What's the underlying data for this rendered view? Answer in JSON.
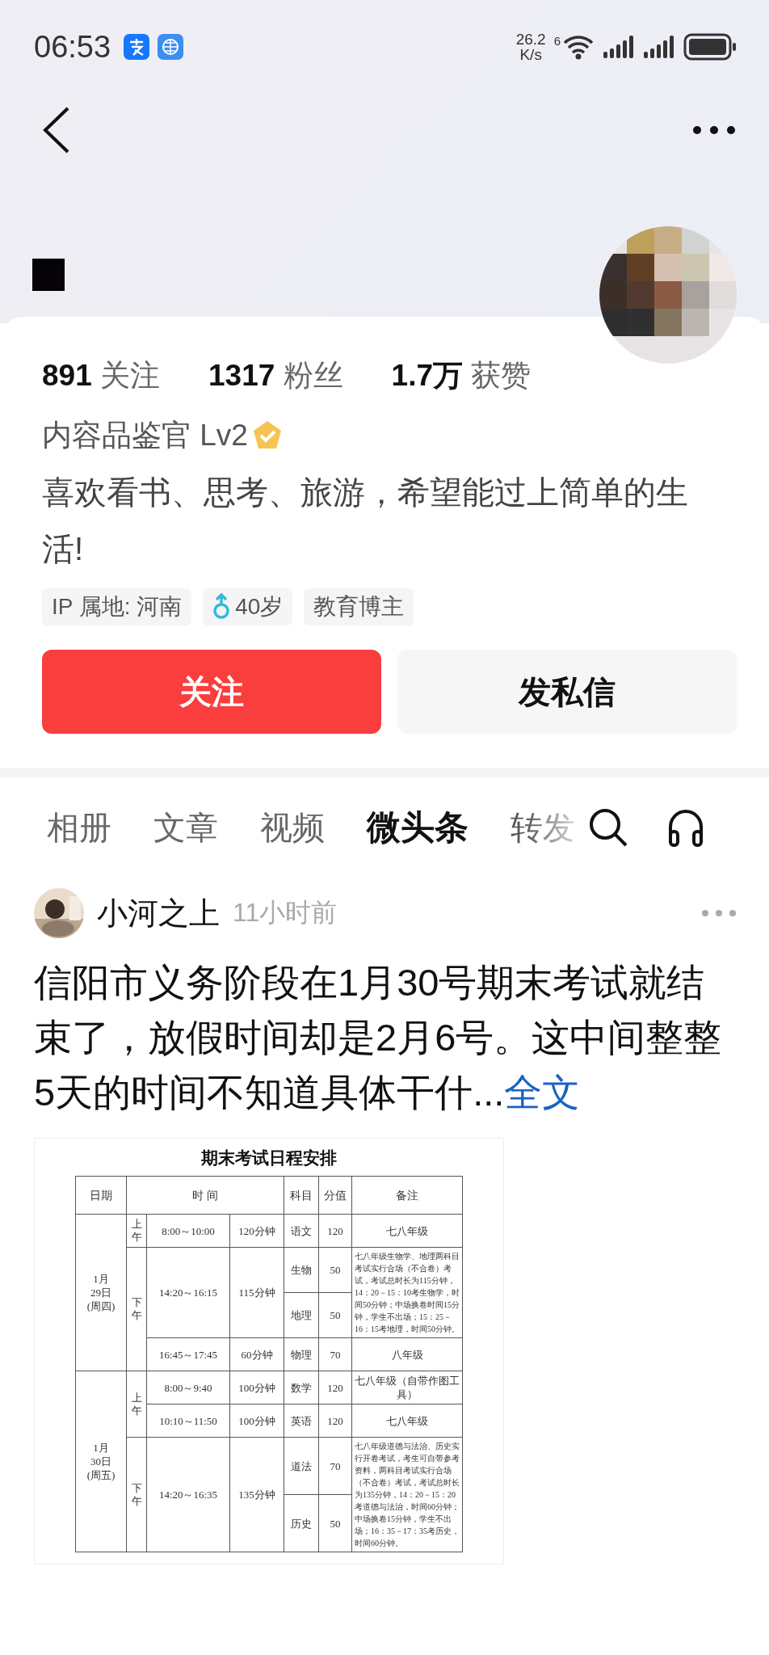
{
  "status_bar": {
    "time": "06:53",
    "speed_value": "26.2",
    "speed_unit": "K/s",
    "wifi_badge": "6"
  },
  "profile": {
    "stats": [
      "**891** 关注",
      "**1317** 粉丝",
      "**1.7万** 获赞"
    ],
    "title": "内容品鉴官 Lv2",
    "verified": true,
    "bio": "喜欢看书、思考、旅游，希望能过上简单的生活!",
    "tags": [
      {
        "kind": "text",
        "label": "IP 属地: 河南"
      },
      {
        "kind": "gender",
        "label": "40岁"
      },
      {
        "kind": "text",
        "label": "教育博主"
      }
    ],
    "buttons": [
      {
        "kind": "primary",
        "label": "关注"
      },
      {
        "kind": "secondary",
        "label": "发私信"
      }
    ]
  },
  "tabs": [
    {
      "label": "相册",
      "selected": false,
      "faded": false
    },
    {
      "label": "文章",
      "selected": false,
      "faded": false
    },
    {
      "label": "视频",
      "selected": false,
      "faded": false
    },
    {
      "label": "微头条",
      "selected": true,
      "faded": false
    },
    {
      "label": "转发",
      "selected": false,
      "faded": true
    }
  ],
  "post": {
    "author": "小河之上",
    "time": "11小时前",
    "text": "信阳市义务阶段在1月30号期末考试就结束了，放假时间却是2月6号。这中间整整5天的时间不知道具体干什...",
    "more_link": "全文",
    "document": {
      "title": "期末考试日程安排",
      "columns": [
        "日期",
        "时 间",
        "科目",
        "分值",
        "备注"
      ],
      "days": [
        {
          "date_lines": [
            "1月",
            "29日",
            "(周四)"
          ],
          "sessions": [
            {
              "half": "上午",
              "slots": [
                {
                  "time": "8:00～10:00",
                  "duration": "120分钟",
                  "subjects": [
                    {
                      "subject": "语文",
                      "score": "120"
                    }
                  ],
                  "note": "七八年级"
                }
              ]
            },
            {
              "half": "下午",
              "slots": [
                {
                  "time": "14:20～16:15",
                  "duration": "115分钟",
                  "subjects": [
                    {
                      "subject": "生物",
                      "score": "50"
                    },
                    {
                      "subject": "地理",
                      "score": "50"
                    }
                  ],
                  "note": "七八年级生物学、地理两科目考试实行合场（不合卷）考试，考试总时长为115分钟，14：20－15：10考生物学，时间50分钟；中场换卷时间15分钟，学生不出场；15：25－16：15考地理，时间50分钟。"
                },
                {
                  "time": "16:45～17:45",
                  "duration": "60分钟",
                  "subjects": [
                    {
                      "subject": "物理",
                      "score": "70"
                    }
                  ],
                  "note": "八年级"
                }
              ]
            }
          ]
        },
        {
          "date_lines": [
            "1月",
            "30日",
            "(周五)"
          ],
          "sessions": [
            {
              "half": "上午",
              "slots": [
                {
                  "time": "8:00～9:40",
                  "duration": "100分钟",
                  "subjects": [
                    {
                      "subject": "数学",
                      "score": "120"
                    }
                  ],
                  "note": "七八年级（自带作图工具）"
                },
                {
                  "time": "10:10～11:50",
                  "duration": "100分钟",
                  "subjects": [
                    {
                      "subject": "英语",
                      "score": "120"
                    }
                  ],
                  "note": "七八年级"
                }
              ]
            },
            {
              "half": "下午",
              "slots": [
                {
                  "time": "14:20～16:35",
                  "duration": "135分钟",
                  "subjects": [
                    {
                      "subject": "道法",
                      "score": "70"
                    },
                    {
                      "subject": "历史",
                      "score": "50"
                    }
                  ],
                  "note": "七八年级道德与法治、历史实行开卷考试，考生可自带参考资料，两科目考试实行合场（不合卷）考试，考试总时长为135分钟，14：20－15：20考道德与法治，时间60分钟；中场换卷15分钟，学生不出场；16：35－17：35考历史，时间60分钟。"
                }
              ]
            }
          ]
        }
      ]
    }
  }
}
